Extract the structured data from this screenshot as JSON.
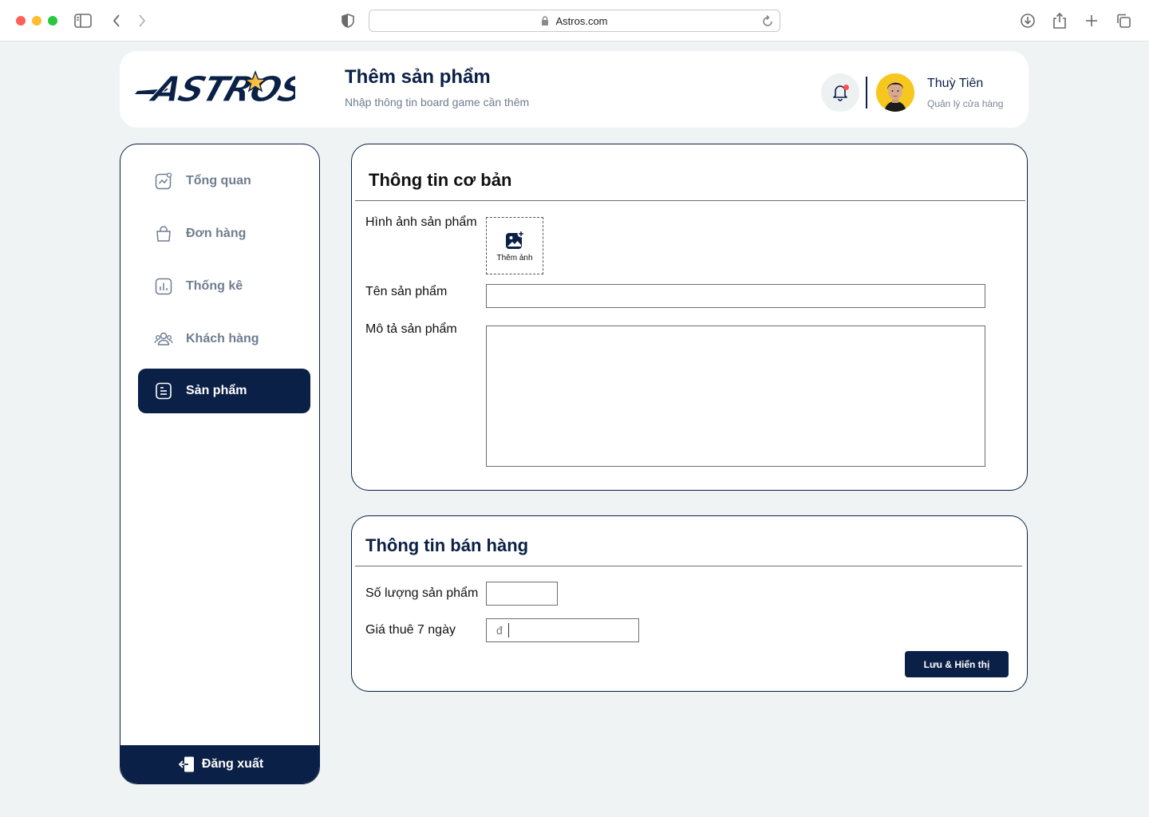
{
  "browser": {
    "url": "Astros.com"
  },
  "header": {
    "logo_text": "ASTROS",
    "title": "Thêm sản phẩm",
    "subtitle": "Nhập thông tin board game cần thêm",
    "user": {
      "name": "Thuỳ Tiên",
      "role": "Quản lý cửa hàng"
    }
  },
  "sidebar": {
    "items": [
      {
        "label": "Tổng quan",
        "icon": "chart-trend-icon",
        "active": false
      },
      {
        "label": "Đơn hàng",
        "icon": "shopping-bag-icon",
        "active": false
      },
      {
        "label": "Thống kê",
        "icon": "bar-chart-icon",
        "active": false
      },
      {
        "label": "Khách hàng",
        "icon": "users-icon",
        "active": false
      },
      {
        "label": "Sản phẩm",
        "icon": "document-icon",
        "active": true
      }
    ],
    "logout_label": "Đăng xuất"
  },
  "basic_info": {
    "title": "Thông tin cơ bản",
    "image_label": "Hình ảnh sản phẩm",
    "upload_label": "Thêm ảnh",
    "name_label": "Tên sản phẩm",
    "name_value": "",
    "desc_label": "Mô tả sản phẩm",
    "desc_value": ""
  },
  "sales_info": {
    "title": "Thông tin bán hàng",
    "qty_label": "Số lượng sản phẩm",
    "qty_value": "",
    "price_label": "Giá thuê 7 ngày",
    "currency": "đ",
    "price_value": "",
    "save_label": "Lưu & Hiển thị"
  },
  "colors": {
    "navy": "#0b2046",
    "background": "#eff3f4",
    "muted": "#6f7d90"
  }
}
